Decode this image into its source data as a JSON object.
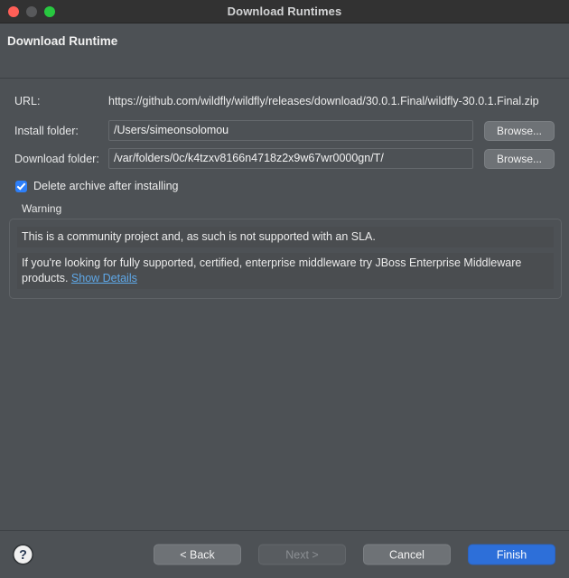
{
  "window": {
    "title": "Download Runtimes",
    "traffic_lights": [
      "close-button",
      "minimize-button",
      "maximize-button"
    ]
  },
  "header": {
    "title": "Download Runtime"
  },
  "form": {
    "url": {
      "label": "URL:",
      "value": "https://github.com/wildfly/wildfly/releases/download/30.0.1.Final/wildfly-30.0.1.Final.zip"
    },
    "install_folder": {
      "label": "Install folder:",
      "value": "/Users/simeonsolomou",
      "browse_label": "Browse..."
    },
    "download_folder": {
      "label": "Download folder:",
      "value": "/var/folders/0c/k4tzxv8166n4718z2x9w67wr0000gn/T/",
      "browse_label": "Browse..."
    },
    "delete_archive": {
      "label": "Delete archive after installing",
      "checked": true
    }
  },
  "warning": {
    "group_title": "Warning",
    "line1": "This is a community project and, as such is not supported with an SLA.",
    "line2": "If you're looking for fully supported, certified, enterprise middleware try JBoss Enterprise Middleware products.",
    "link_label": "Show Details"
  },
  "footer": {
    "help_label": "?",
    "back_label": "< Back",
    "next_label": "Next >",
    "cancel_label": "Cancel",
    "finish_label": "Finish"
  },
  "colors": {
    "window_bg": "#4d5155",
    "titlebar_bg": "#323232",
    "accent_blue": "#2d6fd9",
    "checkbox_blue": "#2d7ff9",
    "link_blue": "#5fa8e8",
    "button_gray": "#6e7276",
    "close_red": "#ff5f57",
    "minimize_gray": "#58595b",
    "maximize_green": "#28c840"
  }
}
